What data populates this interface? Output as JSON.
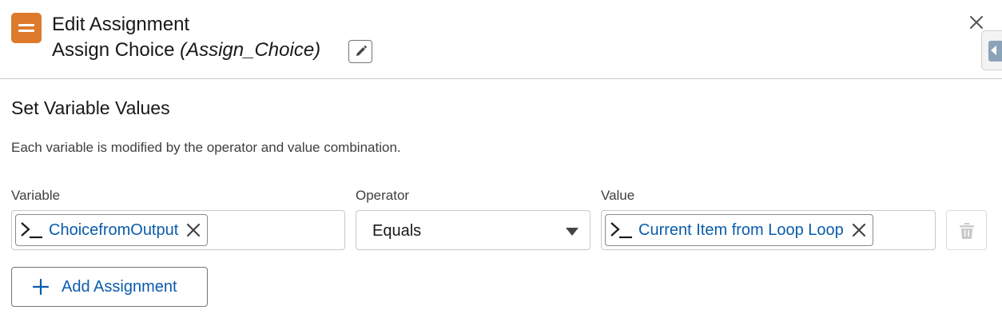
{
  "header": {
    "title": "Edit Assignment",
    "element_label": "Assign Choice",
    "element_api_name": "(Assign_Choice)"
  },
  "section": {
    "title": "Set Variable Values",
    "description": "Each variable is modified by the operator and value combination."
  },
  "assignment_row": {
    "variable_label": "Variable",
    "operator_label": "Operator",
    "value_label": "Value",
    "variable_value": "ChoicefromOutput",
    "operator_value": "Equals",
    "value_value": "Current Item from Loop Loop"
  },
  "actions": {
    "add_assignment_label": "Add Assignment"
  },
  "icons": {
    "app": "assignment-icon",
    "edit": "pencil-icon",
    "close": "close-icon",
    "variable": "variable-icon",
    "remove": "close-icon",
    "dropdown": "chevron-down-icon",
    "delete": "trash-icon",
    "add": "plus-icon",
    "side_panel": "chevron-left-icon"
  },
  "colors": {
    "app_icon_bg": "#dd7a2c",
    "link_blue": "#0b5cab",
    "text": "#181818"
  }
}
